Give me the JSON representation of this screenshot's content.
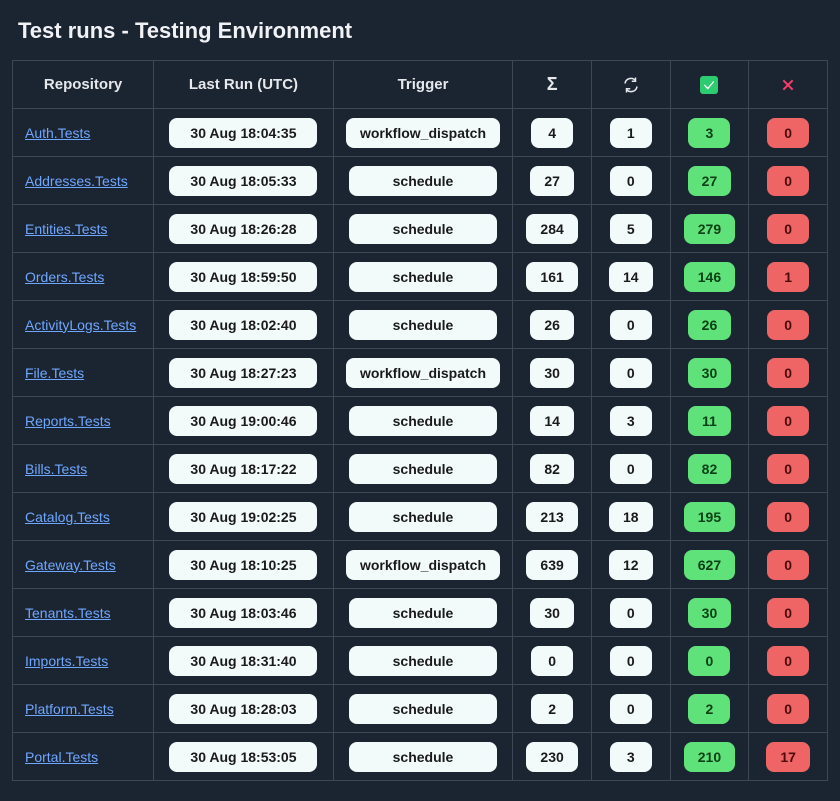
{
  "title": "Test runs - Testing Environment",
  "headers": {
    "repository": "Repository",
    "lastRun": "Last Run (UTC)",
    "trigger": "Trigger",
    "sum": "Σ",
    "skipped": "skipped",
    "passed": "passed",
    "failed": "failed"
  },
  "rows": [
    {
      "repo": "Auth.Tests",
      "lastRun": "30 Aug 18:04:35",
      "trigger": "workflow_dispatch",
      "sum": "4",
      "skipped": "1",
      "passed": "3",
      "failed": "0"
    },
    {
      "repo": "Addresses.Tests",
      "lastRun": "30 Aug 18:05:33",
      "trigger": "schedule",
      "sum": "27",
      "skipped": "0",
      "passed": "27",
      "failed": "0"
    },
    {
      "repo": "Entities.Tests",
      "lastRun": "30 Aug 18:26:28",
      "trigger": "schedule",
      "sum": "284",
      "skipped": "5",
      "passed": "279",
      "failed": "0"
    },
    {
      "repo": "Orders.Tests",
      "lastRun": "30 Aug 18:59:50",
      "trigger": "schedule",
      "sum": "161",
      "skipped": "14",
      "passed": "146",
      "failed": "1"
    },
    {
      "repo": "ActivityLogs.Tests",
      "lastRun": "30 Aug 18:02:40",
      "trigger": "schedule",
      "sum": "26",
      "skipped": "0",
      "passed": "26",
      "failed": "0"
    },
    {
      "repo": "File.Tests",
      "lastRun": "30 Aug 18:27:23",
      "trigger": "workflow_dispatch",
      "sum": "30",
      "skipped": "0",
      "passed": "30",
      "failed": "0"
    },
    {
      "repo": "Reports.Tests",
      "lastRun": "30 Aug 19:00:46",
      "trigger": "schedule",
      "sum": "14",
      "skipped": "3",
      "passed": "11",
      "failed": "0"
    },
    {
      "repo": "Bills.Tests",
      "lastRun": "30 Aug 18:17:22",
      "trigger": "schedule",
      "sum": "82",
      "skipped": "0",
      "passed": "82",
      "failed": "0"
    },
    {
      "repo": "Catalog.Tests",
      "lastRun": "30 Aug 19:02:25",
      "trigger": "schedule",
      "sum": "213",
      "skipped": "18",
      "passed": "195",
      "failed": "0"
    },
    {
      "repo": "Gateway.Tests",
      "lastRun": "30 Aug 18:10:25",
      "trigger": "workflow_dispatch",
      "sum": "639",
      "skipped": "12",
      "passed": "627",
      "failed": "0"
    },
    {
      "repo": "Tenants.Tests",
      "lastRun": "30 Aug 18:03:46",
      "trigger": "schedule",
      "sum": "30",
      "skipped": "0",
      "passed": "30",
      "failed": "0"
    },
    {
      "repo": "Imports.Tests",
      "lastRun": "30 Aug 18:31:40",
      "trigger": "schedule",
      "sum": "0",
      "skipped": "0",
      "passed": "0",
      "failed": "0"
    },
    {
      "repo": "Platform.Tests",
      "lastRun": "30 Aug 18:28:03",
      "trigger": "schedule",
      "sum": "2",
      "skipped": "0",
      "passed": "2",
      "failed": "0"
    },
    {
      "repo": "Portal.Tests",
      "lastRun": "30 Aug 18:53:05",
      "trigger": "schedule",
      "sum": "230",
      "skipped": "3",
      "passed": "210",
      "failed": "17"
    }
  ]
}
